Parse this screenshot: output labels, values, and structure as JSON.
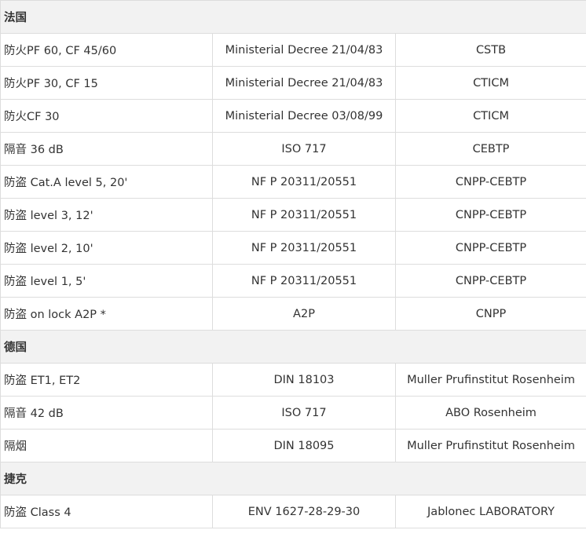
{
  "sections": [
    {
      "title": "法国",
      "rows": [
        [
          "防火PF 60, CF 45/60",
          "Ministerial Decree 21/04/83",
          "CSTB"
        ],
        [
          "防火PF 30, CF 15",
          "Ministerial Decree 21/04/83",
          "CTICM"
        ],
        [
          "防火CF 30",
          "Ministerial Decree 03/08/99",
          "CTICM"
        ],
        [
          "隔音 36 dB",
          "ISO 717",
          "CEBTP"
        ],
        [
          "防盗 Cat.A level 5, 20'",
          "NF P 20311/20551",
          "CNPP-CEBTP"
        ],
        [
          "防盗 level 3, 12'",
          "NF P 20311/20551",
          "CNPP-CEBTP"
        ],
        [
          "防盗 level 2, 10'",
          "NF P 20311/20551",
          "CNPP-CEBTP"
        ],
        [
          "防盗 level 1, 5'",
          "NF P 20311/20551",
          "CNPP-CEBTP"
        ],
        [
          "防盗 on lock A2P *",
          "A2P",
          "CNPP"
        ]
      ]
    },
    {
      "title": "德国",
      "rows": [
        [
          "防盗 ET1, ET2",
          "DIN 18103",
          "Muller Prufinstitut Rosenheim"
        ],
        [
          "隔音 42 dB",
          "ISO 717",
          "ABO Rosenheim"
        ],
        [
          "隔烟",
          "DIN 18095",
          "Muller Prufinstitut Rosenheim"
        ]
      ]
    },
    {
      "title": "捷克",
      "rows": [
        [
          "防盗 Class 4",
          "ENV 1627-28-29-30",
          "Jablonec LABORATORY"
        ]
      ]
    }
  ]
}
